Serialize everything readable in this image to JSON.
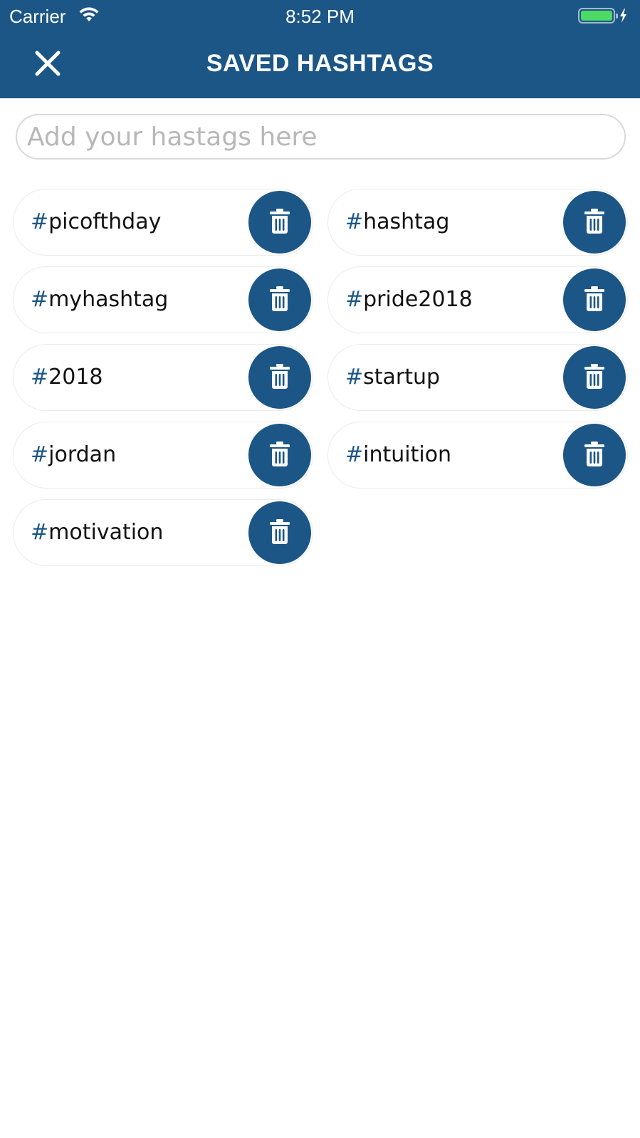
{
  "status_bar": {
    "carrier": "Carrier",
    "time": "8:52 PM",
    "icons": [
      "wifi-icon",
      "battery-icon",
      "charging-icon"
    ],
    "battery_color": "#4cd964"
  },
  "header": {
    "title": "SAVED HASHTAGS",
    "close_icon": "close-icon",
    "background_color": "#1b5686"
  },
  "search": {
    "placeholder": "Add your hastags here",
    "value": ""
  },
  "hashtags": [
    {
      "symbol": "#",
      "label": "picofthday"
    },
    {
      "symbol": "#",
      "label": "hashtag"
    },
    {
      "symbol": "#",
      "label": "myhashtag"
    },
    {
      "symbol": "#",
      "label": "pride2018"
    },
    {
      "symbol": "#",
      "label": "2018"
    },
    {
      "symbol": "#",
      "label": "startup"
    },
    {
      "symbol": "#",
      "label": "jordan"
    },
    {
      "symbol": "#",
      "label": "intuition"
    },
    {
      "symbol": "#",
      "label": "motivation"
    }
  ],
  "delete_icon": "trash-icon",
  "accent_color": "#1b5686"
}
